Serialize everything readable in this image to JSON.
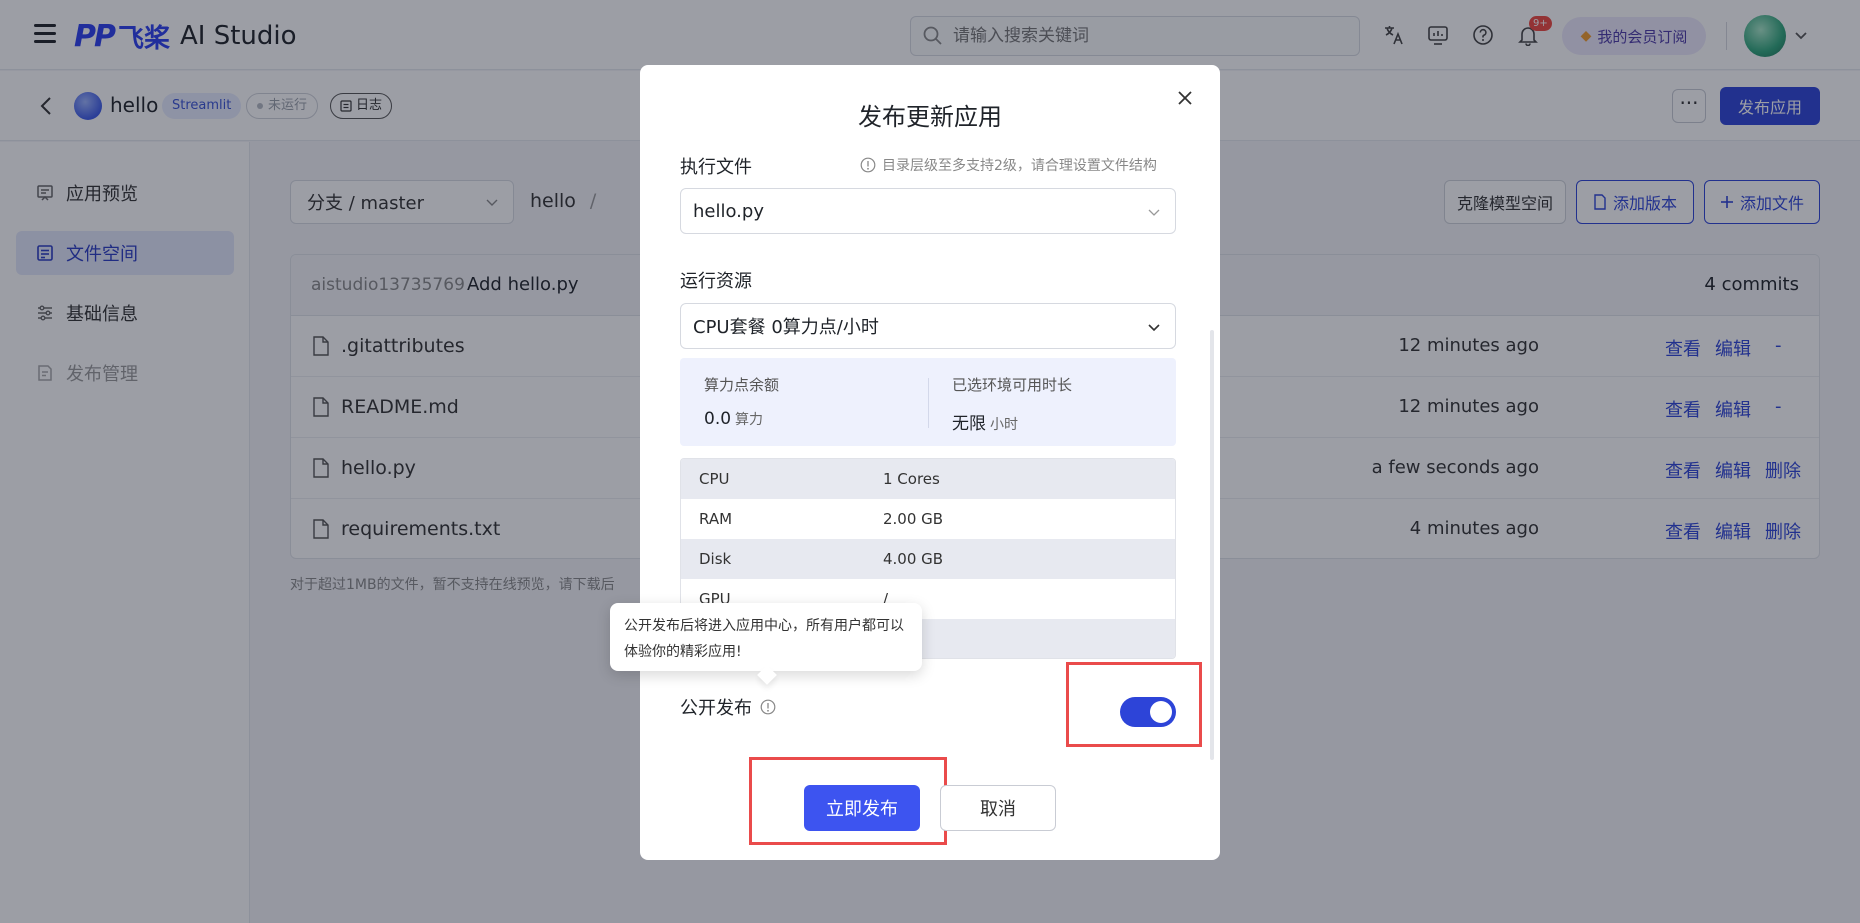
{
  "header": {
    "logo_mark": "PP",
    "logo_cn": "飞桨",
    "logo_text": "AI Studio",
    "search_placeholder": "请输入搜索关键词",
    "notification_badge": "9+",
    "member_label": "我的会员订阅"
  },
  "subheader": {
    "project_name": "hello",
    "tag_framework": "Streamlit",
    "tag_status": "未运行",
    "tag_log": "日志",
    "more_label": "···",
    "publish_label": "发布应用"
  },
  "sidebar": {
    "items": [
      {
        "label": "应用预览",
        "icon": "preview-icon"
      },
      {
        "label": "文件空间",
        "icon": "file-space-icon"
      },
      {
        "label": "基础信息",
        "icon": "settings-list-icon"
      },
      {
        "label": "发布管理",
        "icon": "publish-manage-icon"
      }
    ]
  },
  "main": {
    "branch_label": "分支 / master",
    "breadcrumb_root": "hello",
    "breadcrumb_sep": "/",
    "clone_label": "克隆模型空间",
    "add_version_label": "添加版本",
    "add_file_label": "添加文件",
    "commit": {
      "author": "aistudio13735769",
      "message": "Add hello.py",
      "count": "4 commits"
    },
    "files": [
      {
        "name": ".gitattributes",
        "time": "12 minutes ago",
        "view": "查看",
        "edit": "编辑",
        "delete": "-"
      },
      {
        "name": "README.md",
        "time": "12 minutes ago",
        "view": "查看",
        "edit": "编辑",
        "delete": "-"
      },
      {
        "name": "hello.py",
        "time": "a few seconds ago",
        "view": "查看",
        "edit": "编辑",
        "delete": "删除"
      },
      {
        "name": "requirements.txt",
        "time": "4 minutes ago",
        "view": "查看",
        "edit": "编辑",
        "delete": "删除"
      }
    ],
    "note": "对于超过1MB的文件，暂不支持在线预览，请下载后"
  },
  "modal": {
    "title": "发布更新应用",
    "exec_file_label": "执行文件",
    "exec_file_hint": "目录层级至多支持2级，请合理设置文件结构",
    "exec_file_value": "hello.py",
    "resource_label": "运行资源",
    "resource_value": "CPU套餐 0算力点/小时",
    "balance_label": "算力点余额",
    "balance_value": "0.0",
    "balance_unit": "算力",
    "duration_label": "已选环境可用时长",
    "duration_value": "无限",
    "duration_unit": "小时",
    "specs": [
      {
        "key": "CPU",
        "value": "1 Cores"
      },
      {
        "key": "RAM",
        "value": "2.00 GB"
      },
      {
        "key": "Disk",
        "value": "4.00 GB"
      },
      {
        "key": "GPU",
        "value": "/"
      },
      {
        "key": "",
        "value": ""
      }
    ],
    "tooltip": "公开发布后将进入应用中心，所有用户都可以体验你的精彩应用!",
    "public_label": "公开发布",
    "public_enabled": true,
    "submit_label": "立即发布",
    "cancel_label": "取消"
  },
  "colors": {
    "brand": "#2d44d8",
    "highlight": "#ea4b4b",
    "toggle_on": "#2d44d8"
  }
}
